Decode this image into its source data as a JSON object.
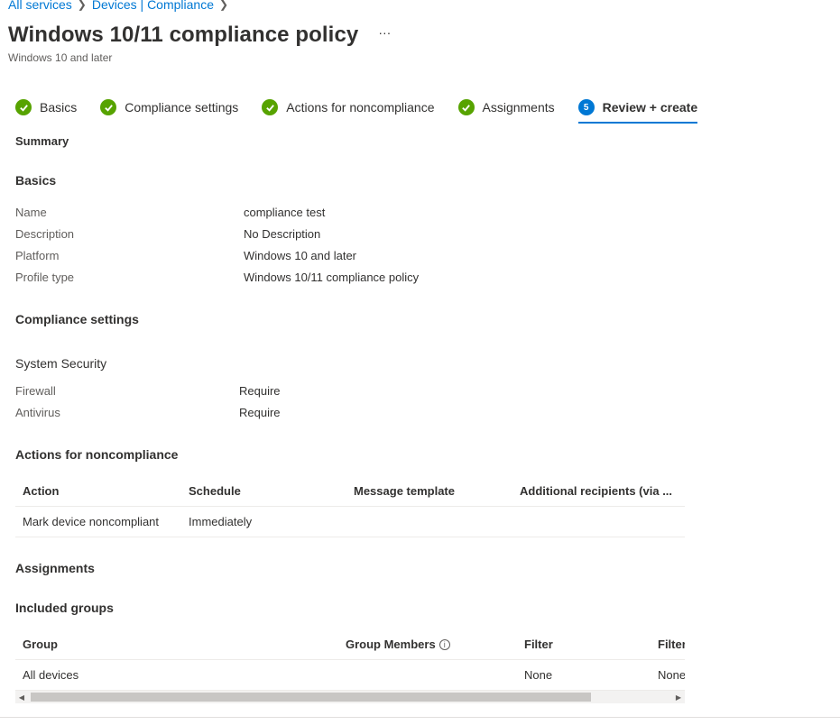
{
  "breadcrumb": {
    "items": [
      "All services",
      "Devices | Compliance"
    ]
  },
  "header": {
    "title": "Windows 10/11 compliance policy",
    "more": "···",
    "subtitle": "Windows 10 and later"
  },
  "wizard": {
    "steps": [
      {
        "label": "Basics",
        "state": "complete"
      },
      {
        "label": "Compliance settings",
        "state": "complete"
      },
      {
        "label": "Actions for noncompliance",
        "state": "complete"
      },
      {
        "label": "Assignments",
        "state": "complete"
      },
      {
        "label": "Review + create",
        "state": "current",
        "number": "5"
      }
    ]
  },
  "summary": {
    "title": "Summary",
    "basics": {
      "title": "Basics",
      "rows": [
        {
          "label": "Name",
          "value": "compliance test"
        },
        {
          "label": "Description",
          "value": "No Description"
        },
        {
          "label": "Platform",
          "value": "Windows 10 and later"
        },
        {
          "label": "Profile type",
          "value": "Windows 10/11 compliance policy"
        }
      ]
    },
    "compliance_settings": {
      "title": "Compliance settings",
      "group": "System Security",
      "rows": [
        {
          "label": "Firewall",
          "value": "Require"
        },
        {
          "label": "Antivirus",
          "value": "Require"
        }
      ]
    },
    "actions": {
      "title": "Actions for noncompliance",
      "columns": [
        "Action",
        "Schedule",
        "Message template",
        "Additional recipients (via ..."
      ],
      "rows": [
        [
          "Mark device noncompliant",
          "Immediately",
          "",
          ""
        ]
      ]
    },
    "assignments": {
      "title": "Assignments",
      "included_title": "Included groups",
      "columns": [
        "Group",
        "Group Members",
        "Filter",
        "Filter"
      ],
      "rows": [
        [
          "All devices",
          "",
          "None",
          "None"
        ]
      ]
    }
  },
  "colors": {
    "accent": "#0078d4",
    "success": "#57a300"
  }
}
